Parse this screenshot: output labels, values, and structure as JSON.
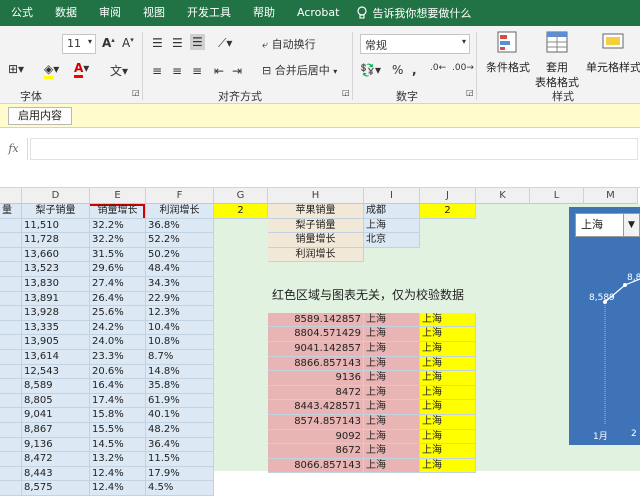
{
  "tabs": [
    "公式",
    "数据",
    "审阅",
    "视图",
    "开发工具",
    "帮助",
    "Acrobat"
  ],
  "tell_me": "告诉我你想要做什么",
  "ribbon": {
    "font_size": "11",
    "font_group": "字体",
    "align_group": "对齐方式",
    "wrap_text": "自动换行",
    "merge_center": "合并后居中",
    "number_format": "常规",
    "number_group": "数字",
    "percent": "%",
    "comma": ",",
    "conditional_format": "条件格式",
    "format_table_1": "套用",
    "format_table_2": "表格格式",
    "cell_styles": "单元格样式",
    "styles_group": "样式"
  },
  "security": {
    "enable_content": "启用内容"
  },
  "formula_bar": {
    "fx": "fx"
  },
  "columns": [
    {
      "label": "D",
      "w": 68
    },
    {
      "label": "E",
      "w": 56
    },
    {
      "label": "F",
      "w": 68
    },
    {
      "label": "G",
      "w": 54
    },
    {
      "label": "H",
      "w": 96
    },
    {
      "label": "I",
      "w": 56
    },
    {
      "label": "J",
      "w": 56
    },
    {
      "label": "K",
      "w": 54
    },
    {
      "label": "L",
      "w": 54
    },
    {
      "label": "M",
      "w": 54
    }
  ],
  "headers": {
    "c_partial": "量",
    "d": "梨子销量",
    "e": "销量增长",
    "f": "利润增长",
    "g_value": "2",
    "j_value": "2"
  },
  "rows": [
    {
      "d": "11,510",
      "e": "32.2%",
      "f": "36.8%"
    },
    {
      "d": "11,728",
      "e": "32.2%",
      "f": "52.2%"
    },
    {
      "d": "13,660",
      "e": "31.5%",
      "f": "50.2%"
    },
    {
      "d": "13,523",
      "e": "29.6%",
      "f": "48.4%"
    },
    {
      "d": "13,830",
      "e": "27.4%",
      "f": "34.3%"
    },
    {
      "d": "13,891",
      "e": "26.4%",
      "f": "22.9%"
    },
    {
      "d": "13,928",
      "e": "25.6%",
      "f": "12.3%"
    },
    {
      "d": "13,335",
      "e": "24.2%",
      "f": "10.4%"
    },
    {
      "d": "13,905",
      "e": "24.0%",
      "f": "10.8%"
    },
    {
      "d": "13,614",
      "e": "23.3%",
      "f": "8.7%"
    },
    {
      "d": "12,543",
      "e": "20.6%",
      "f": "14.8%"
    },
    {
      "d": "8,589",
      "e": "16.4%",
      "f": "35.8%"
    },
    {
      "d": "8,805",
      "e": "17.4%",
      "f": "61.9%"
    },
    {
      "d": "9,041",
      "e": "15.8%",
      "f": "40.1%"
    },
    {
      "d": "8,867",
      "e": "15.5%",
      "f": "48.2%"
    },
    {
      "d": "9,136",
      "e": "14.5%",
      "f": "36.4%"
    },
    {
      "d": "8,472",
      "e": "13.2%",
      "f": "11.5%"
    },
    {
      "d": "8,443",
      "e": "12.4%",
      "f": "17.9%"
    },
    {
      "d": "8,575",
      "e": "12.4%",
      "f": "4.5%"
    }
  ],
  "menu_table": [
    {
      "h": "苹果销量",
      "i": "成都"
    },
    {
      "h": "梨子销量",
      "i": "上海"
    },
    {
      "h": "销量增长",
      "i": "北京"
    },
    {
      "h": "利润增长",
      "i": ""
    }
  ],
  "note": "红色区域与图表无关，仅为校验数据",
  "check_rows": [
    {
      "h": "8589.142857",
      "i": "上海",
      "j": "上海"
    },
    {
      "h": "8804.571429",
      "i": "上海",
      "j": "上海"
    },
    {
      "h": "9041.142857",
      "i": "上海",
      "j": "上海"
    },
    {
      "h": "8866.857143",
      "i": "上海",
      "j": "上海"
    },
    {
      "h": "9136",
      "i": "上海",
      "j": "上海"
    },
    {
      "h": "8472",
      "i": "上海",
      "j": "上海"
    },
    {
      "h": "8443.428571",
      "i": "上海",
      "j": "上海"
    },
    {
      "h": "8574.857143",
      "i": "上海",
      "j": "上海"
    },
    {
      "h": "9092",
      "i": "上海",
      "j": "上海"
    },
    {
      "h": "8672",
      "i": "上海",
      "j": "上海"
    },
    {
      "h": "8066.857143",
      "i": "上海",
      "j": "上海"
    }
  ],
  "chart": {
    "selector": "上海",
    "label_1": "8,589",
    "label_2": "8,8",
    "axis_1": "1月",
    "axis_2": "2"
  },
  "colors": {
    "excel_green": "#217346",
    "chart_blue": "#3f73b8",
    "highlight": "#ffff00"
  }
}
